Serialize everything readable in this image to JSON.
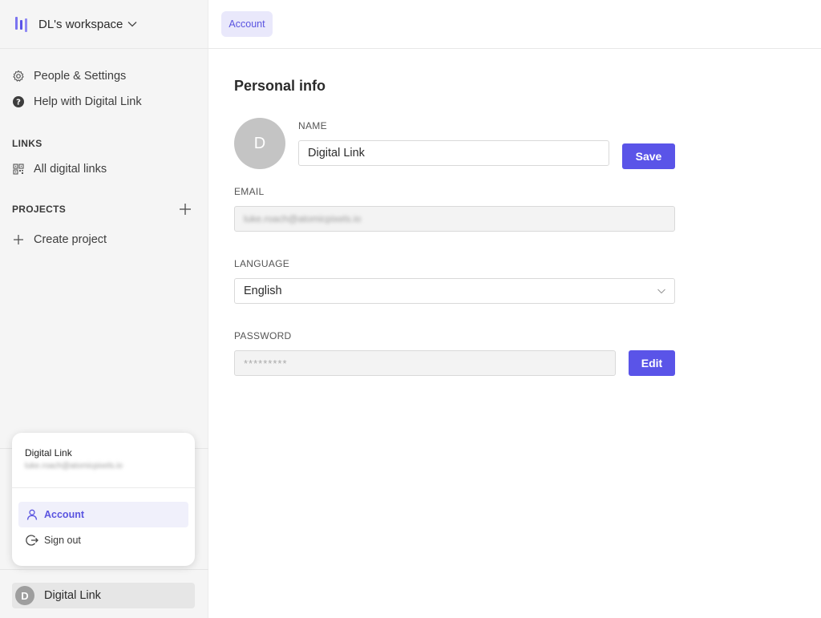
{
  "workspace": {
    "title": "DL's workspace"
  },
  "sidebar": {
    "items": [
      {
        "label": "People & Settings"
      },
      {
        "label": "Help with Digital Link"
      }
    ],
    "links_section": {
      "label": "LINKS",
      "items": [
        {
          "label": "All digital links"
        }
      ]
    },
    "projects_section": {
      "label": "PROJECTS",
      "create_label": "Create project"
    }
  },
  "popup": {
    "name": "Digital Link",
    "email": "luke.roach@atomicpixels.io",
    "items": [
      {
        "label": "Account"
      },
      {
        "label": "Sign out"
      }
    ]
  },
  "user": {
    "name": "Digital Link",
    "initial": "D"
  },
  "topbar": {
    "tab_label": "Account"
  },
  "main": {
    "title": "Personal info",
    "avatar_initial": "D",
    "name_label": "NAME",
    "name_value": "Digital Link",
    "save_label": "Save",
    "email_label": "EMAIL",
    "email_value": "luke.roach@atomicpixels.io",
    "language_label": "LANGUAGE",
    "language_value": "English",
    "password_label": "PASSWORD",
    "password_value": "*********",
    "edit_label": "Edit"
  },
  "colors": {
    "accent": "#5a54e8",
    "accent_soft": "#e9e8fb",
    "sidebar_bg": "#f5f5f5"
  }
}
